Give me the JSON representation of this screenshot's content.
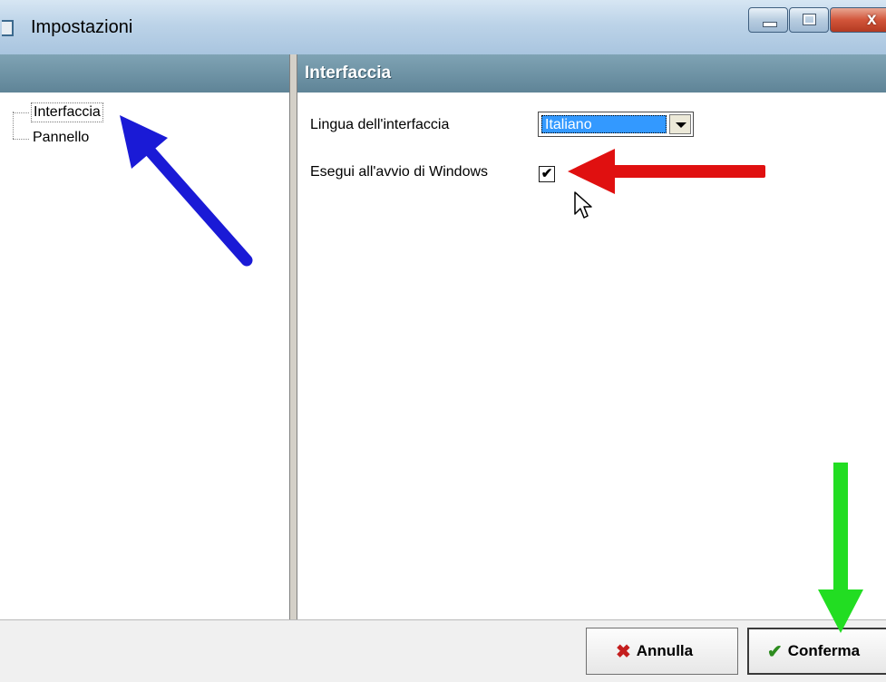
{
  "window": {
    "title": "Impostazioni",
    "close_glyph": "x"
  },
  "tree": {
    "items": [
      {
        "label": "Interfaccia",
        "selected": true
      },
      {
        "label": "Pannello",
        "selected": false
      }
    ]
  },
  "panel": {
    "header": "Interfaccia",
    "language_label": "Lingua dell'interfaccia",
    "language_value": "Italiano",
    "startup_label": "Esegui all'avvio di Windows",
    "startup_checked": true,
    "check_mark": "✔"
  },
  "buttons": {
    "cancel_label": "Annulla",
    "confirm_label": "Conferma",
    "cancel_icon": "✖",
    "confirm_icon": "✔"
  },
  "colors": {
    "selection": "#3399ff",
    "header_bg": "#6a8ea0",
    "arrow_blue": "#1a1ad6",
    "arrow_red": "#e01010",
    "arrow_green": "#22dd22"
  }
}
